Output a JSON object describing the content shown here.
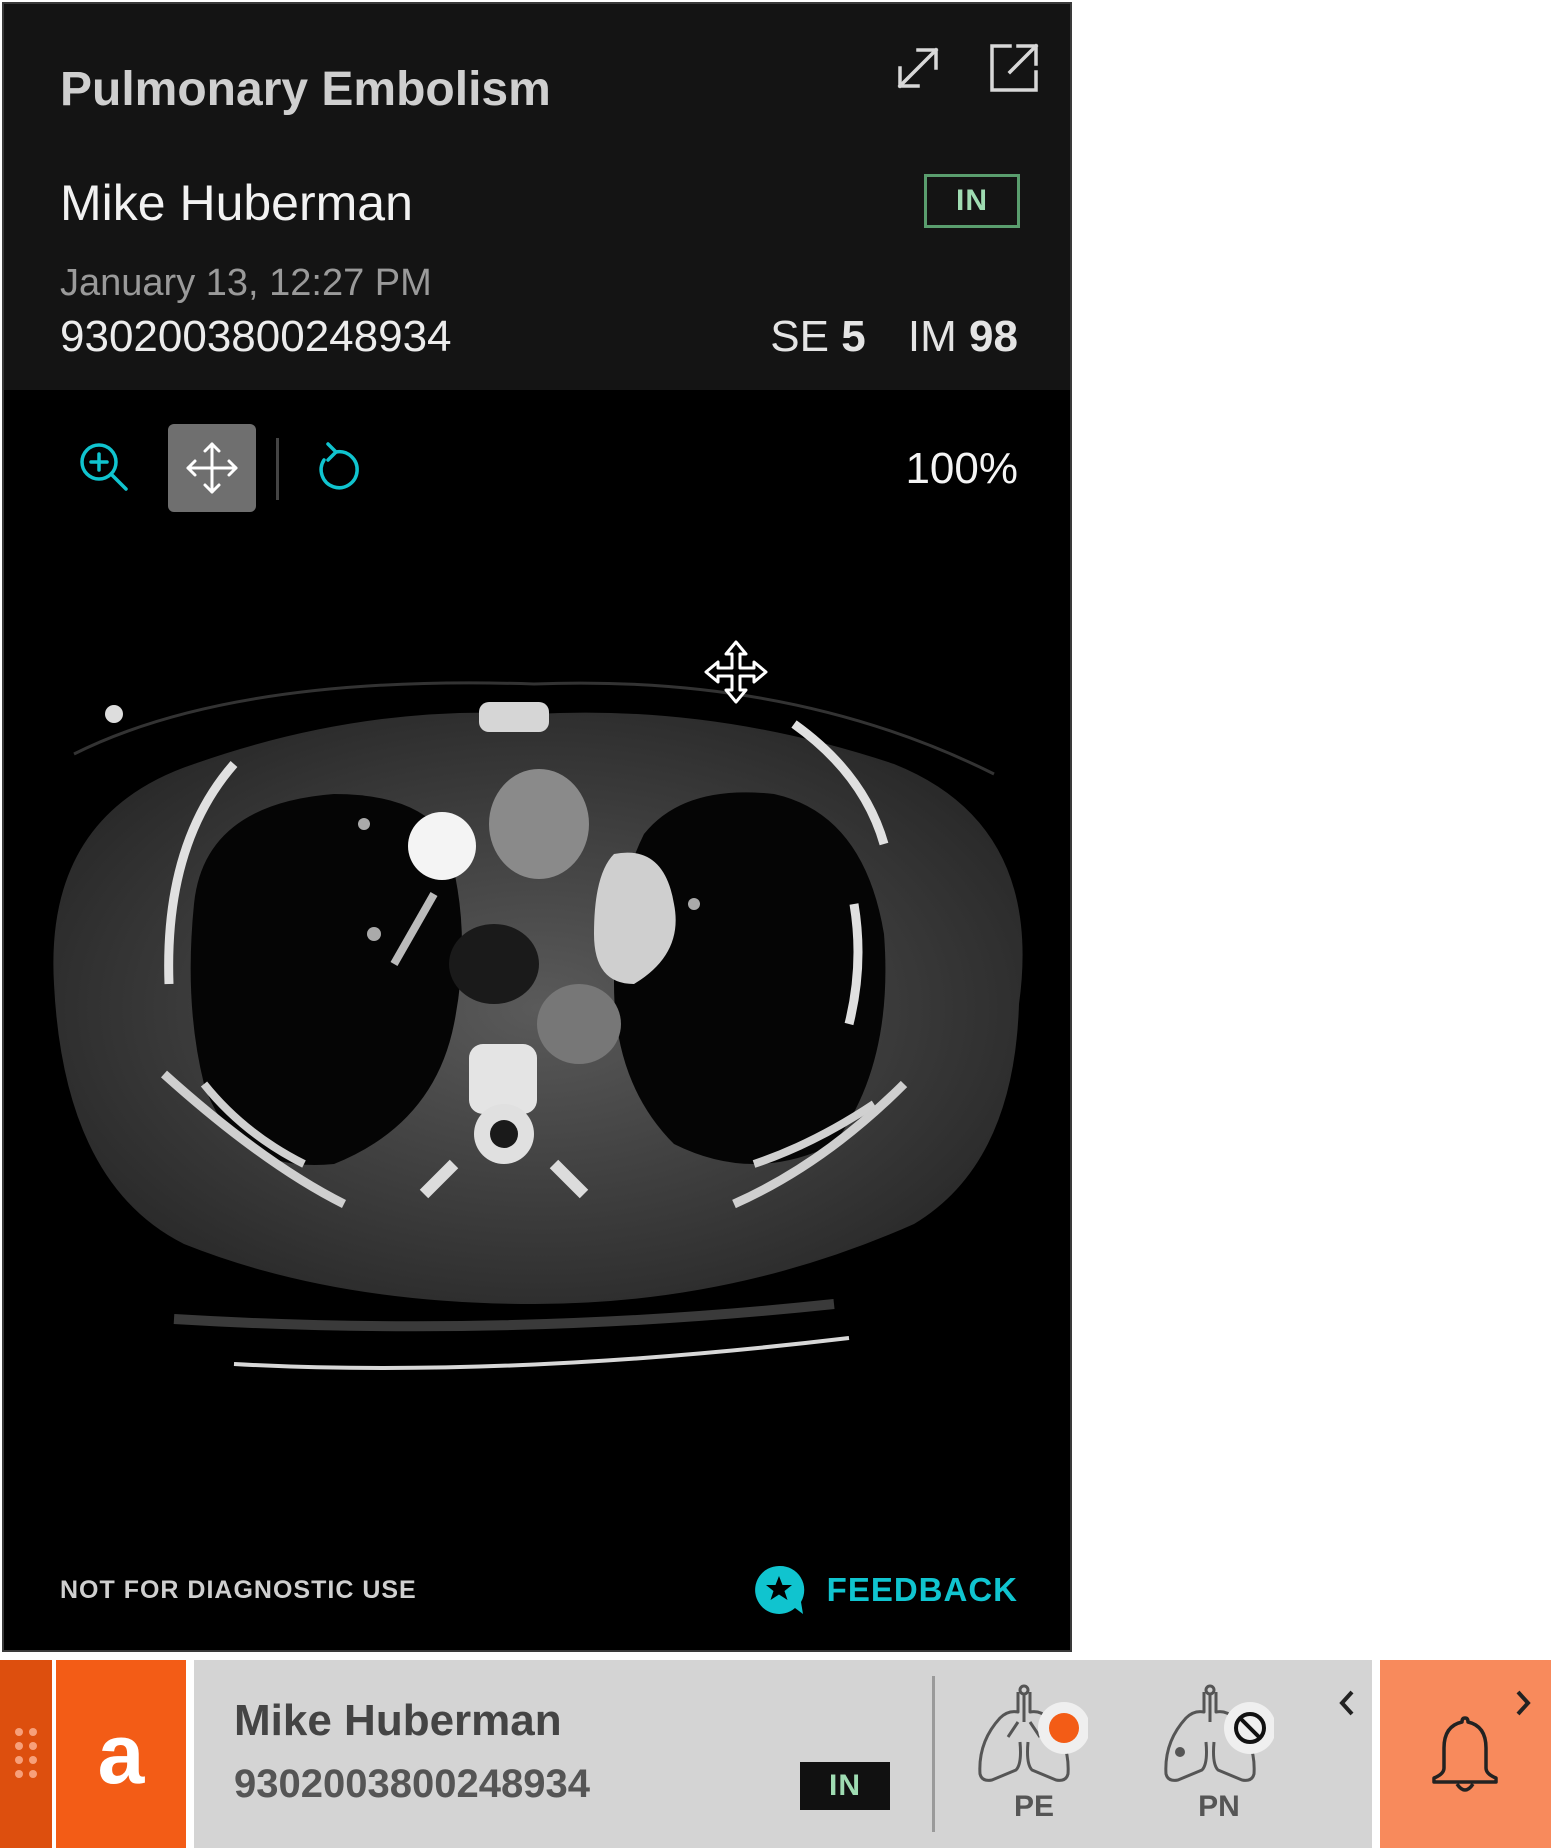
{
  "panel": {
    "title": "Pulmonary Embolism",
    "patient_name": "Mike Huberman",
    "status": "IN",
    "study_date": "January 13, 12:27 PM",
    "accession": "9302003800248934",
    "series_label": "SE",
    "series_value": "5",
    "image_label": "IM",
    "image_value": "98",
    "zoom_level": "100%",
    "disclaimer": "NOT FOR DIAGNOSTIC USE",
    "feedback_label": "FEEDBACK",
    "icons": [
      "expand-icon",
      "open-external-icon",
      "zoom-in-icon",
      "pan-icon",
      "reset-icon",
      "move-cursor-icon",
      "feedback-star-icon"
    ]
  },
  "bar": {
    "logo_letter": "a",
    "patient_name": "Mike Huberman",
    "accession": "9302003800248934",
    "status": "IN",
    "findings": [
      {
        "label": "PE",
        "state": "positive",
        "indicator_color": "#f35c16"
      },
      {
        "label": "PN",
        "state": "not-analyzed"
      }
    ],
    "icons": [
      "drag-grip-icon",
      "chevron-left-icon",
      "chevron-right-icon",
      "bell-icon"
    ]
  },
  "colors": {
    "accent_teal": "#10c4cf",
    "brand_orange": "#f35c16",
    "status_green": "#9fdcb2",
    "bell_bg": "#f88a5c"
  }
}
